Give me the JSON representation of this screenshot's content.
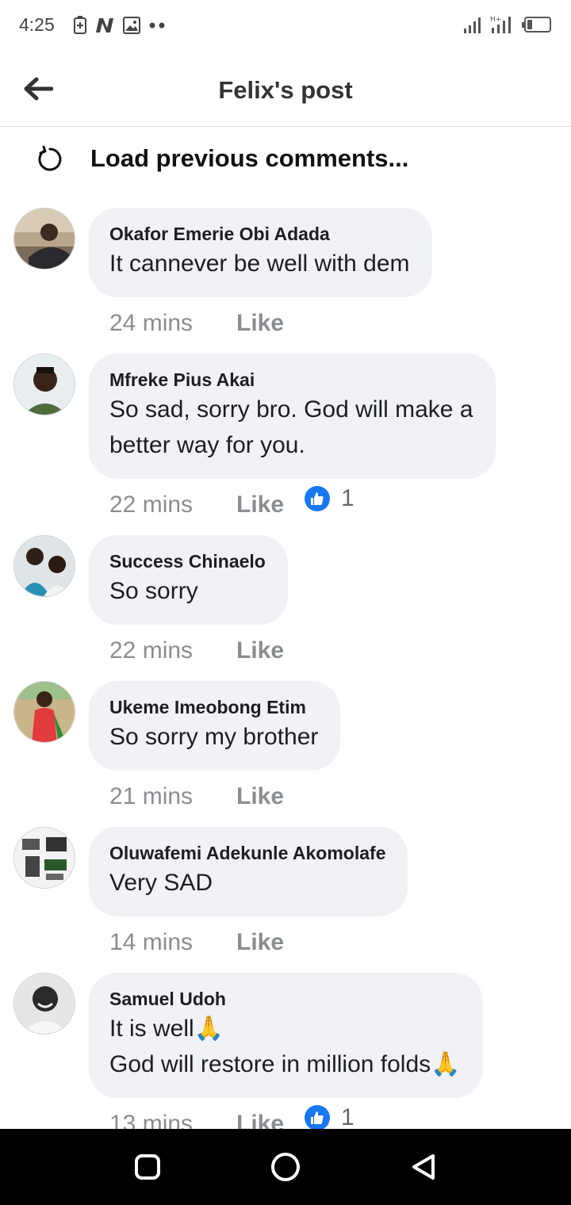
{
  "status_bar": {
    "time": "4:25"
  },
  "header": {
    "title": "Felix's post"
  },
  "load_previous": {
    "label": "Load previous comments..."
  },
  "comments": [
    {
      "author": "Okafor Emerie Obi Adada",
      "lines": [
        "It cannever be well with dem"
      ],
      "time": "24 mins",
      "like_label": "Like",
      "reaction_count": ""
    },
    {
      "author": "Mfreke Pius Akai",
      "lines": [
        "So sad, sorry bro. God will make a",
        "better way for you."
      ],
      "time": "22 mins",
      "like_label": "Like",
      "reaction_count": "1"
    },
    {
      "author": "Success Chinaelo",
      "lines": [
        "So sorry"
      ],
      "time": "22 mins",
      "like_label": "Like",
      "reaction_count": ""
    },
    {
      "author": "Ukeme Imeobong Etim",
      "lines": [
        "So sorry my brother"
      ],
      "time": "21 mins",
      "like_label": "Like",
      "reaction_count": ""
    },
    {
      "author": "Oluwafemi Adekunle Akomolafe",
      "lines": [
        "Very SAD"
      ],
      "time": "14 mins",
      "like_label": "Like",
      "reaction_count": ""
    },
    {
      "author": "Samuel Udoh",
      "lines": [
        "It is well🙏",
        "God will restore in million folds🙏"
      ],
      "time": "13 mins",
      "like_label": "Like",
      "reaction_count": "1"
    }
  ],
  "icons": {
    "back": "arrow-left-icon",
    "load": "refresh-icon",
    "reaction": "thumbs-up-icon",
    "nav": [
      "square-home-icon",
      "circle-home-icon",
      "triangle-back-icon"
    ]
  },
  "colors": {
    "bubble": "#f0f2f5",
    "like_blue": "#1877f2",
    "meta_gray": "#8a8d91"
  }
}
